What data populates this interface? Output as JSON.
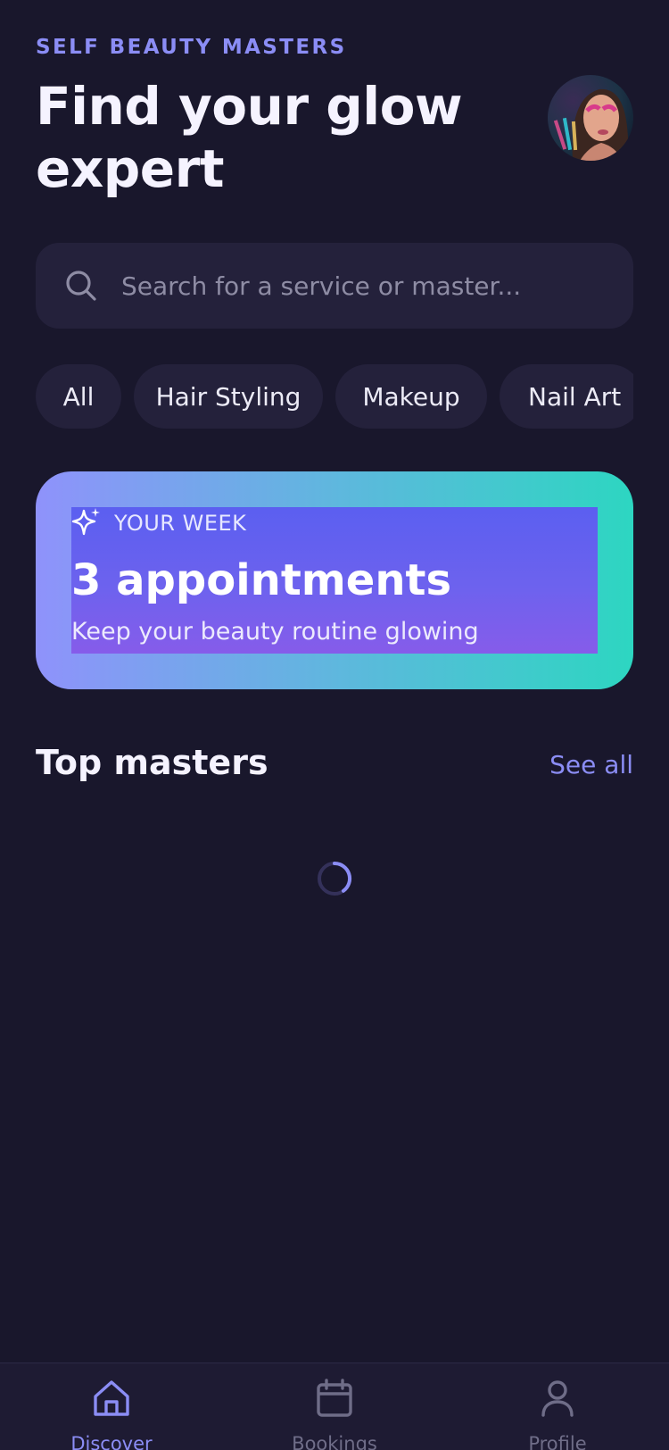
{
  "app": {
    "brand": "SELF BEAUTY MASTERS"
  },
  "header": {
    "headline": "Find your glow expert"
  },
  "search": {
    "placeholder": "Search for a service or master..."
  },
  "categories": [
    "All",
    "Hair Styling",
    "Makeup",
    "Nail Art"
  ],
  "week_card": {
    "label": "YOUR WEEK",
    "count": "3 appointments",
    "subtitle": "Keep your beauty routine glowing"
  },
  "top_masters": {
    "title": "Top masters",
    "see_all": "See all"
  },
  "tabbar": {
    "items": [
      {
        "label": "Discover",
        "icon": "home-icon"
      },
      {
        "label": "Bookings",
        "icon": "calendar-icon"
      },
      {
        "label": "Profile",
        "icon": "user-icon"
      }
    ]
  },
  "colors": {
    "background": "#19172c",
    "accent": "#8b8df5",
    "surface": "#24213b",
    "gradient_start": "#8f92fb",
    "gradient_end": "#2dd6c1"
  }
}
